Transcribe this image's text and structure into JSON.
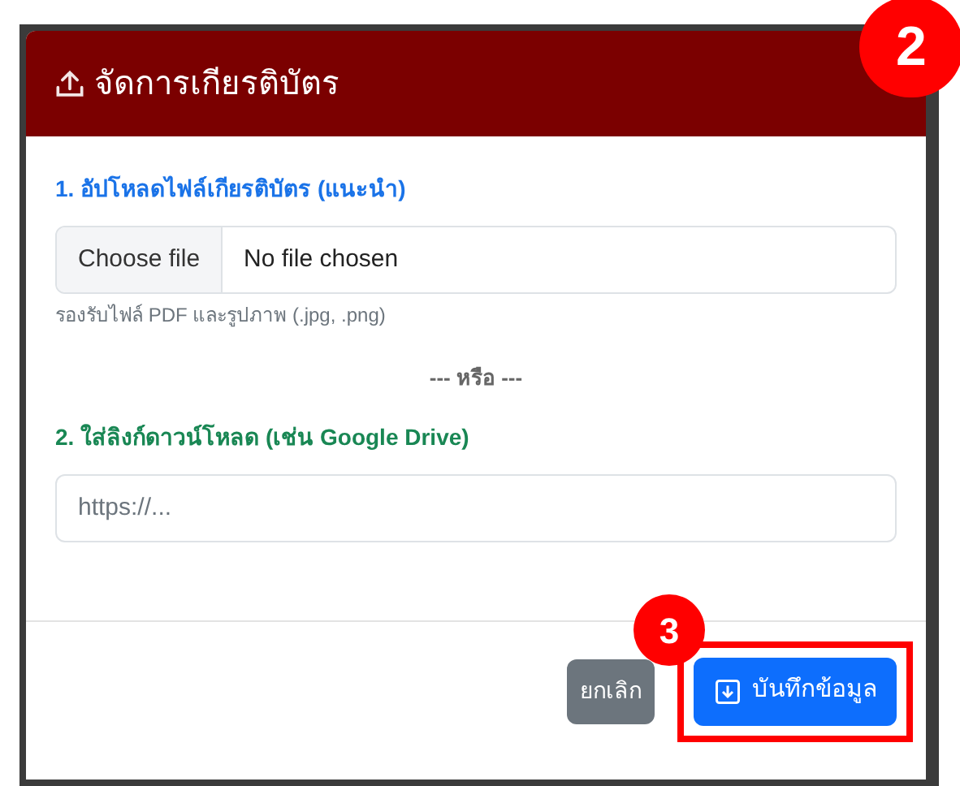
{
  "modal": {
    "title": "จัดการเกียรติบัตร"
  },
  "upload": {
    "label": "1. อัปโหลดไฟล์เกียรติบัตร (แนะนำ)",
    "button": "Choose file",
    "value": "No file chosen",
    "hint": "รองรับไฟล์ PDF และรูปภาพ (.jpg, .png)"
  },
  "divider": "--- หรือ ---",
  "link": {
    "label": "2. ใส่ลิงก์ดาวน์โหลด (เช่น Google Drive)",
    "placeholder": "https://..."
  },
  "buttons": [
    {
      "kind": "cancel",
      "label": "ยกเลิก"
    },
    {
      "kind": "save",
      "label": "บันทึกข้อมูล"
    }
  ],
  "badges": [
    {
      "kind": "header",
      "label": "2"
    },
    {
      "kind": "save",
      "label": "3"
    }
  ]
}
